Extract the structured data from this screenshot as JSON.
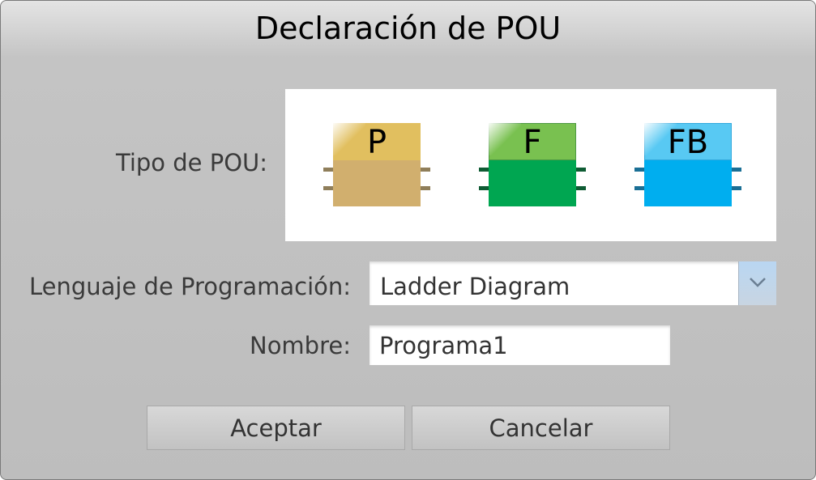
{
  "dialog": {
    "title": "Declaración de POU"
  },
  "pou_type": {
    "label": "Tipo de POU:",
    "options": [
      {
        "letter": "P",
        "icon": "program-icon",
        "color_top": "#e1bf5f",
        "color_bottom": "#d1af6e"
      },
      {
        "letter": "F",
        "icon": "function-icon",
        "color_top": "#79c150",
        "color_bottom": "#00a651"
      },
      {
        "letter": "FB",
        "icon": "function-block-icon",
        "color_top": "#58c9f3",
        "color_bottom": "#00aeef"
      }
    ]
  },
  "language": {
    "label": "Lenguaje de Programación:",
    "selected": "Ladder Diagram",
    "dropdown_icon": "chevron-down-icon"
  },
  "name": {
    "label": "Nombre:",
    "value": "Programa1"
  },
  "buttons": {
    "accept": "Aceptar",
    "cancel": "Cancelar"
  }
}
